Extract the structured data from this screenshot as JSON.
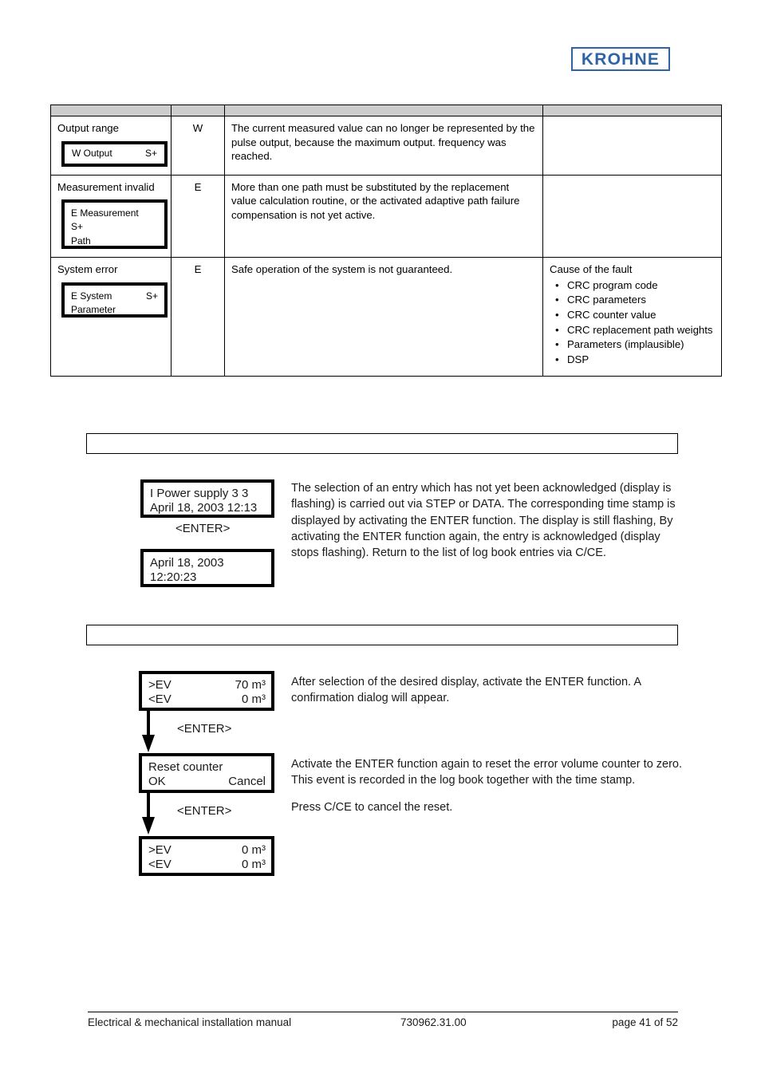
{
  "logo": {
    "text": "KROHNE"
  },
  "fault_table": {
    "columns": [
      "",
      "",
      "",
      ""
    ],
    "rows": [
      {
        "name": "Output range",
        "type": "W",
        "display": {
          "kind": "one-line",
          "left": "W Output",
          "right": "S+"
        },
        "description": "The current measured value can no longer be represented by the pulse output, because the maximum output. frequency was reached.",
        "cause_title": "",
        "causes": []
      },
      {
        "name": "Measurement invalid",
        "type": "E",
        "display": {
          "kind": "lines",
          "lines": [
            "E Measurement",
            "S+",
            "Path"
          ]
        },
        "description": "More than one path must be substituted by the replacement value calculation routine, or the activated adaptive path failure compensation is not yet active.",
        "cause_title": "",
        "causes": []
      },
      {
        "name": "System error",
        "type": "E",
        "display": {
          "kind": "mixed",
          "left": "E System",
          "right": "S+",
          "second": "Parameter"
        },
        "description": "Safe operation of the system is not guaranteed.",
        "cause_title": "Cause of the fault",
        "causes": [
          "CRC program code",
          "CRC parameters",
          "CRC counter value",
          "CRC replacement path weights",
          "Parameters (implausible)",
          "DSP"
        ]
      }
    ]
  },
  "section_logbook": {
    "heading": "",
    "display_1": {
      "line1": "I Power supply 3 3",
      "line2": "April 18, 2003 12:13"
    },
    "enter_label": "<ENTER>",
    "display_2": {
      "line1": "April 18, 2003",
      "line2": "12:20:23"
    },
    "text": "The selection of an entry which has not yet been acknowledged (display is flashing) is carried out via STEP or DATA.  The corresponding time stamp is displayed by activating the ENTER function. The display is still flashing, By activating the ENTER function again, the entry is acknowledged (display stops flashing). Return to the list of log book entries via C/CE."
  },
  "section_reset": {
    "heading": "",
    "display_1": {
      "row1_left": ">EV",
      "row1_right": "70 m³",
      "row2_left": "<EV",
      "row2_right": "0 m³"
    },
    "enter_label_1": "<ENTER>",
    "display_2": {
      "row1_left": "Reset counter",
      "row1_right": "",
      "row2_left": "OK",
      "row2_right": "Cancel"
    },
    "enter_label_2": "<ENTER>",
    "display_3": {
      "row1_left": ">EV",
      "row1_right": "0 m³",
      "row2_left": "<EV",
      "row2_right": "0 m³"
    },
    "text_1": "After selection of the desired display, activate the ENTER function. A confirmation dialog will appear.",
    "text_2": "Activate the ENTER function again to reset the error volume counter to zero. This event is recorded in the log book together with the time stamp.",
    "text_3": "Press C/CE to cancel the reset."
  },
  "footer": {
    "left": "Electrical & mechanical installation manual",
    "middle": "730962.31.00",
    "right": "page 41 of 52"
  },
  "colors": {
    "brand_blue": "#2f63a8",
    "table_header_gray": "#cccccc",
    "ink": "#000000"
  }
}
